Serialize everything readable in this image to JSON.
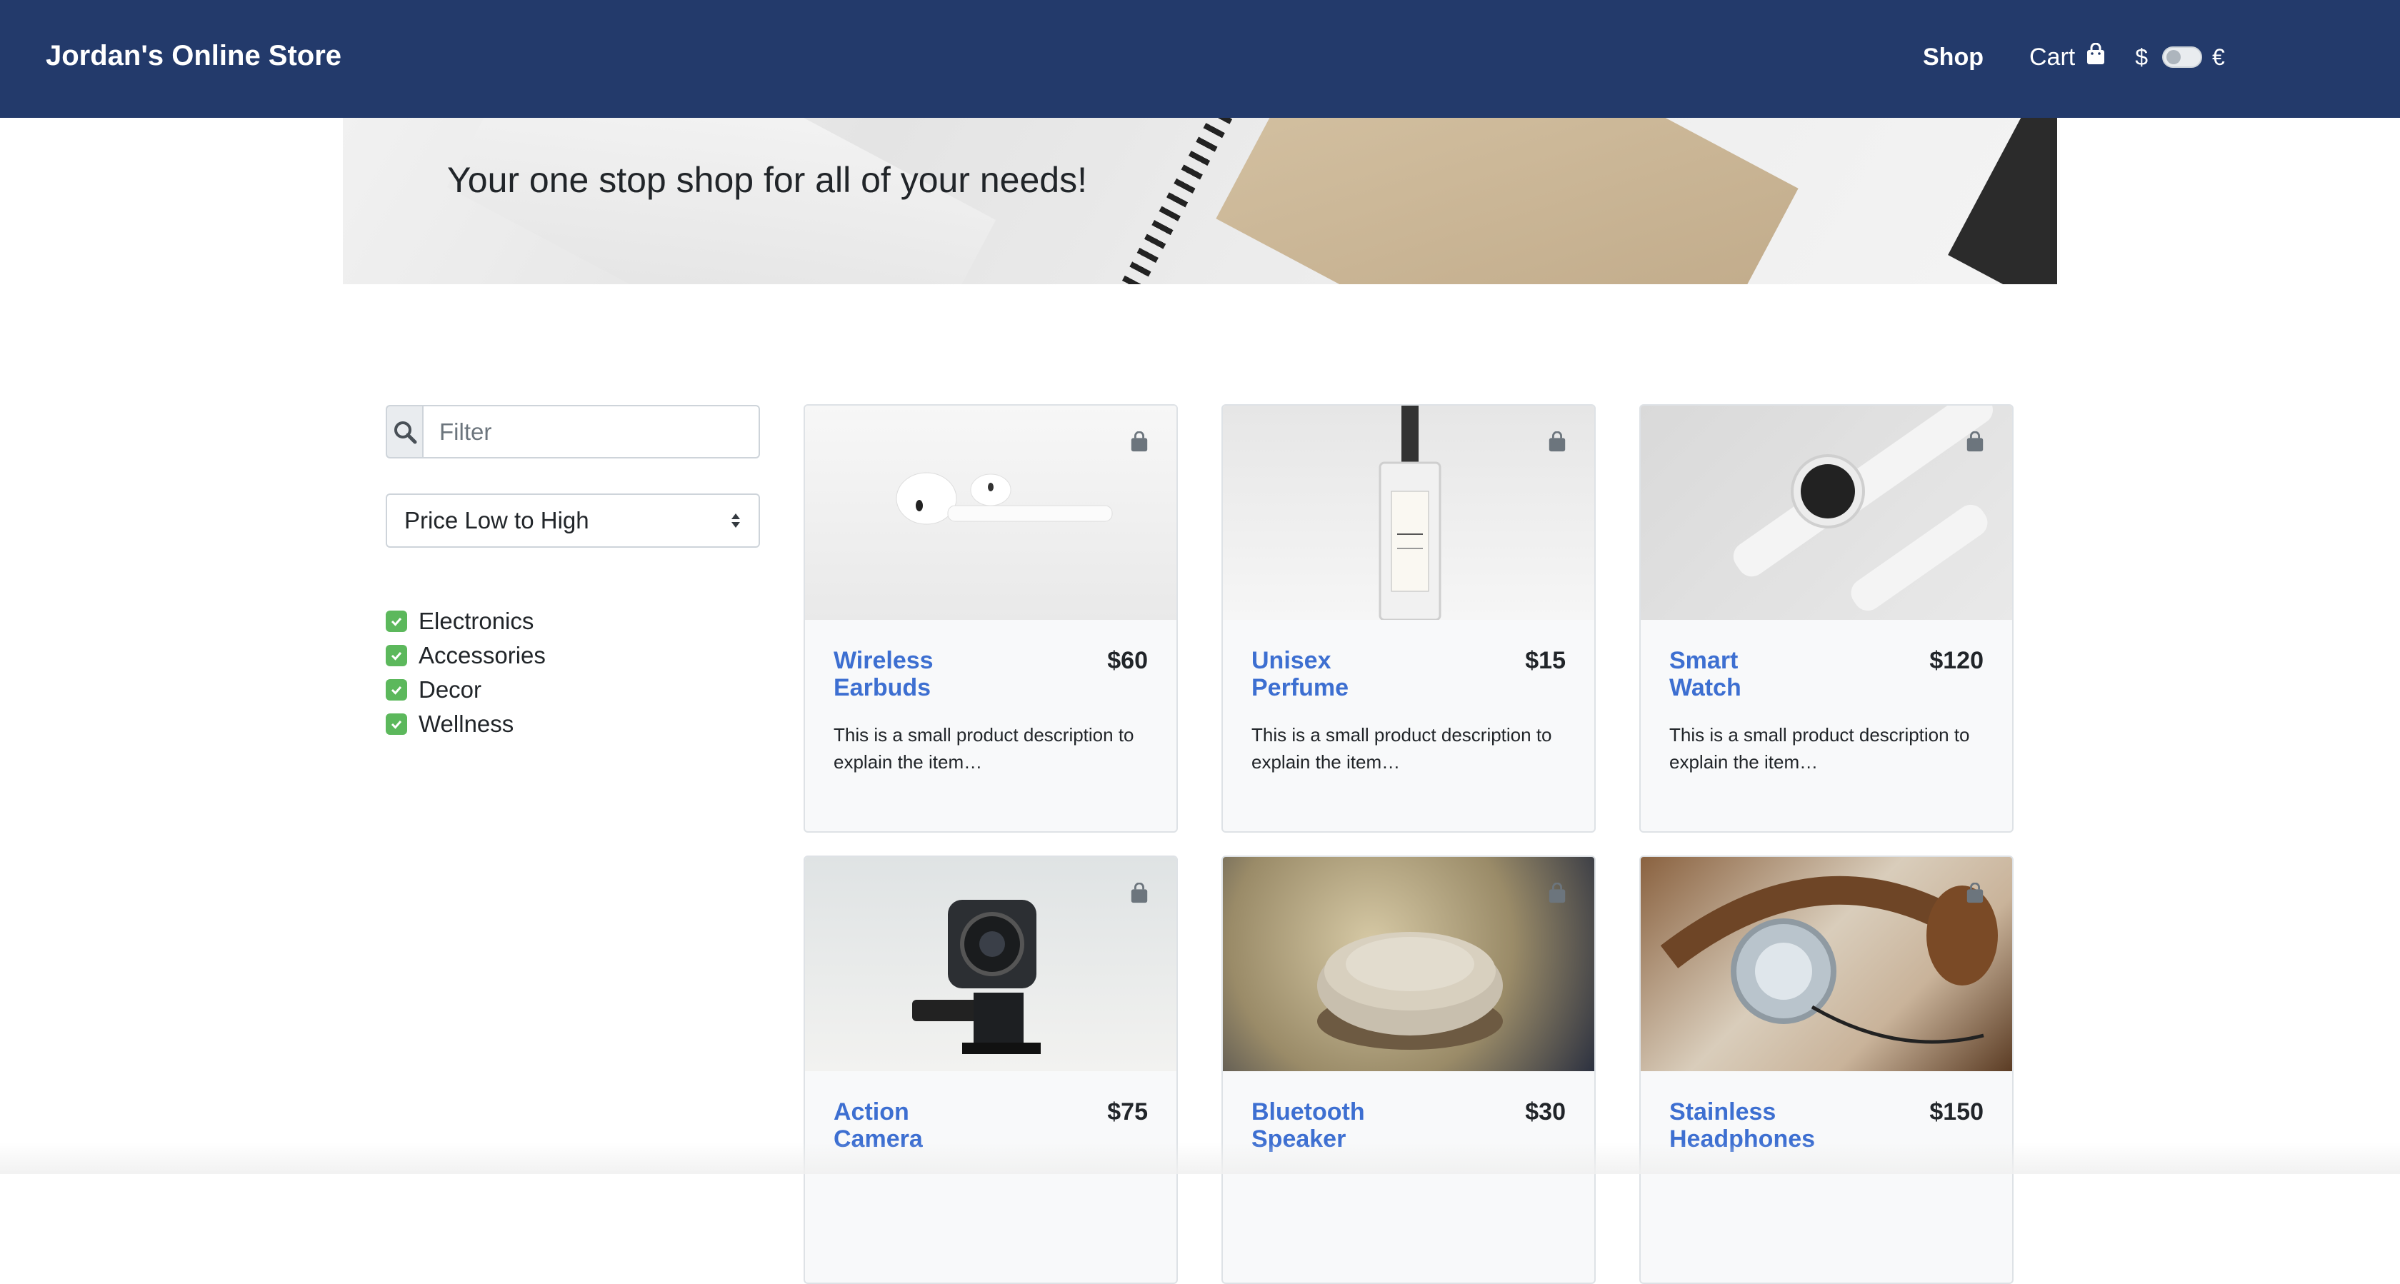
{
  "navbar": {
    "brand": "Jordan's Online Store",
    "shop_label": "Shop",
    "cart_label": "Cart",
    "currency_left": "$",
    "currency_right": "€",
    "bg_color": "#233a6b"
  },
  "hero": {
    "title": "Your one stop shop for all of your needs!"
  },
  "sidebar": {
    "filter_placeholder": "Filter",
    "filter_value": "",
    "sort_selected": "Price Low to High",
    "categories": [
      {
        "label": "Electronics",
        "checked": true
      },
      {
        "label": "Accessories",
        "checked": true
      },
      {
        "label": "Decor",
        "checked": true
      },
      {
        "label": "Wellness",
        "checked": true
      }
    ]
  },
  "products": [
    {
      "name_line1": "Wireless",
      "name_line2": "Earbuds",
      "price": "$60",
      "description": "This is a small product description to explain the item…"
    },
    {
      "name_line1": "Unisex",
      "name_line2": "Perfume",
      "price": "$15",
      "description": "This is a small product description to explain the item…"
    },
    {
      "name_line1": "Smart",
      "name_line2": "Watch",
      "price": "$120",
      "description": "This is a small product description to explain the item…"
    },
    {
      "name_line1": "Action",
      "name_line2": "Camera",
      "price": "$75",
      "description": ""
    },
    {
      "name_line1": "Bluetooth",
      "name_line2": "Speaker",
      "price": "$30",
      "description": ""
    },
    {
      "name_line1": "Stainless",
      "name_line2": "Headphones",
      "price": "$150",
      "description": ""
    }
  ],
  "colors": {
    "accent": "#3d6fd1",
    "check": "#5cb85c"
  }
}
